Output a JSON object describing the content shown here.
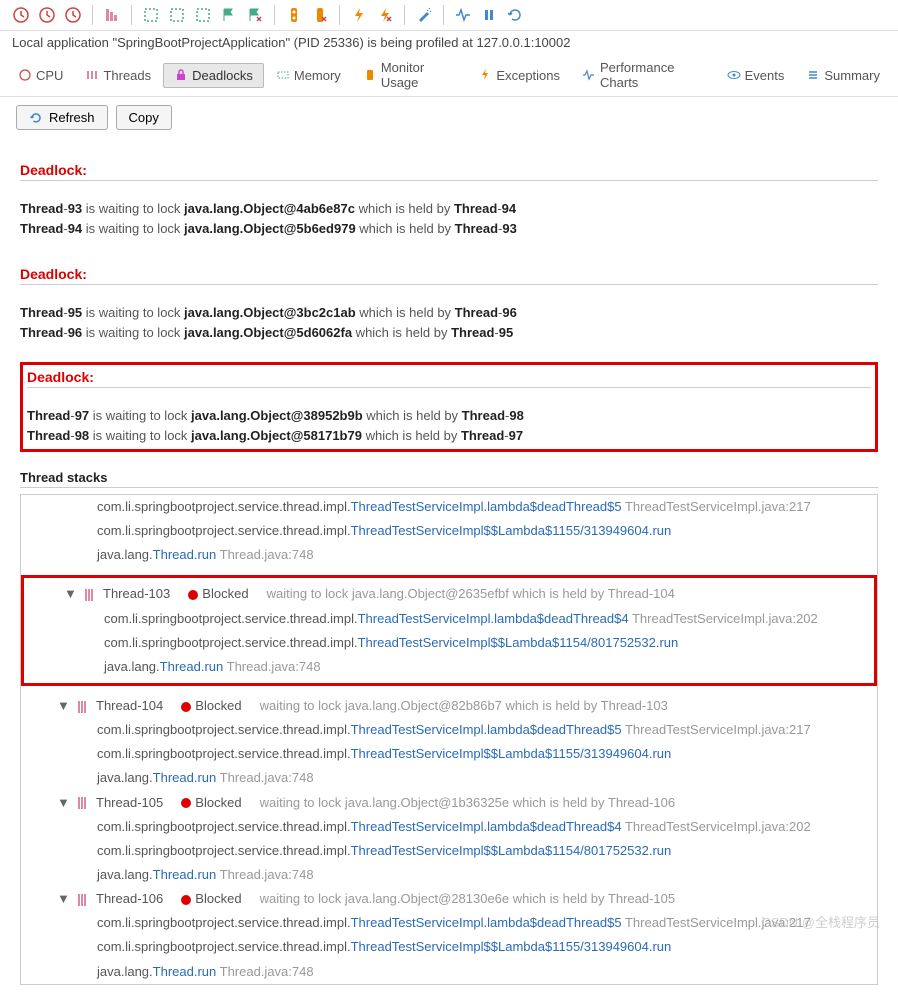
{
  "status": "Local application \"SpringBootProjectApplication\" (PID 25336) is being profiled at 127.0.0.1:10002",
  "tabs": {
    "cpu": "CPU",
    "threads": "Threads",
    "deadlocks": "Deadlocks",
    "memory": "Memory",
    "monitor": "Monitor Usage",
    "exceptions": "Exceptions",
    "charts": "Performance Charts",
    "events": "Events",
    "summary": "Summary"
  },
  "buttons": {
    "refresh": "Refresh",
    "copy": "Copy"
  },
  "deadlocks_title": "Deadlock:",
  "deadlocks": [
    {
      "t1": "Thread-93",
      "obj1": "java.lang.Object@4ab6e87c",
      "h1": "Thread-94",
      "t2": "Thread-94",
      "obj2": "java.lang.Object@5b6ed979",
      "h2": "Thread-93",
      "hl": false
    },
    {
      "t1": "Thread-95",
      "obj1": "java.lang.Object@3bc2c1ab",
      "h1": "Thread-96",
      "t2": "Thread-96",
      "obj2": "java.lang.Object@5d6062fa",
      "h2": "Thread-95",
      "hl": false
    },
    {
      "t1": "Thread-97",
      "obj1": "java.lang.Object@38952b9b",
      "h1": "Thread-98",
      "t2": "Thread-98",
      "obj2": "java.lang.Object@58171b79",
      "h2": "Thread-97",
      "hl": true
    }
  ],
  "waiting_txt": " is waiting to lock ",
  "held_txt": " which is held by ",
  "thread_stacks_title": "Thread stacks",
  "blocked": "Blocked",
  "wait_prefix": "waiting to lock ",
  "pkg_prefix": "com.li.springbootproject.service.thread.impl.",
  "java_lang": "java.lang.",
  "thread_run": "Thread.run",
  "thread_run_loc": " Thread.java:748",
  "top_stack": [
    {
      "method": "ThreadTestServiceImpl.lambda$deadThread$5",
      "loc": " ThreadTestServiceImpl.java:217"
    },
    {
      "method": "ThreadTestServiceImpl$$Lambda$1155/313949604.run",
      "loc": ""
    }
  ],
  "threads": [
    {
      "name": "Thread-103",
      "wait_obj": "java.lang.Object@2635efbf",
      "held_by": "Thread-104",
      "hl": true,
      "stack": [
        {
          "method": "ThreadTestServiceImpl.lambda$deadThread$4",
          "loc": " ThreadTestServiceImpl.java:202"
        },
        {
          "method": "ThreadTestServiceImpl$$Lambda$1154/801752532.run",
          "loc": ""
        }
      ]
    },
    {
      "name": "Thread-104",
      "wait_obj": "java.lang.Object@82b86b7",
      "held_by": "Thread-103",
      "hl": false,
      "stack": [
        {
          "method": "ThreadTestServiceImpl.lambda$deadThread$5",
          "loc": " ThreadTestServiceImpl.java:217"
        },
        {
          "method": "ThreadTestServiceImpl$$Lambda$1155/313949604.run",
          "loc": ""
        }
      ]
    },
    {
      "name": "Thread-105",
      "wait_obj": "java.lang.Object@1b36325e",
      "held_by": "Thread-106",
      "hl": false,
      "stack": [
        {
          "method": "ThreadTestServiceImpl.lambda$deadThread$4",
          "loc": " ThreadTestServiceImpl.java:202"
        },
        {
          "method": "ThreadTestServiceImpl$$Lambda$1154/801752532.run",
          "loc": ""
        }
      ]
    },
    {
      "name": "Thread-106",
      "wait_obj": "java.lang.Object@28130e6e",
      "held_by": "Thread-105",
      "hl": false,
      "stack": [
        {
          "method": "ThreadTestServiceImpl.lambda$deadThread$5",
          "loc": " ThreadTestServiceImpl.java:217"
        },
        {
          "method": "ThreadTestServiceImpl$$Lambda$1155/313949604.run",
          "loc": ""
        }
      ]
    }
  ],
  "watermark": "CSDN @全栈程序员"
}
